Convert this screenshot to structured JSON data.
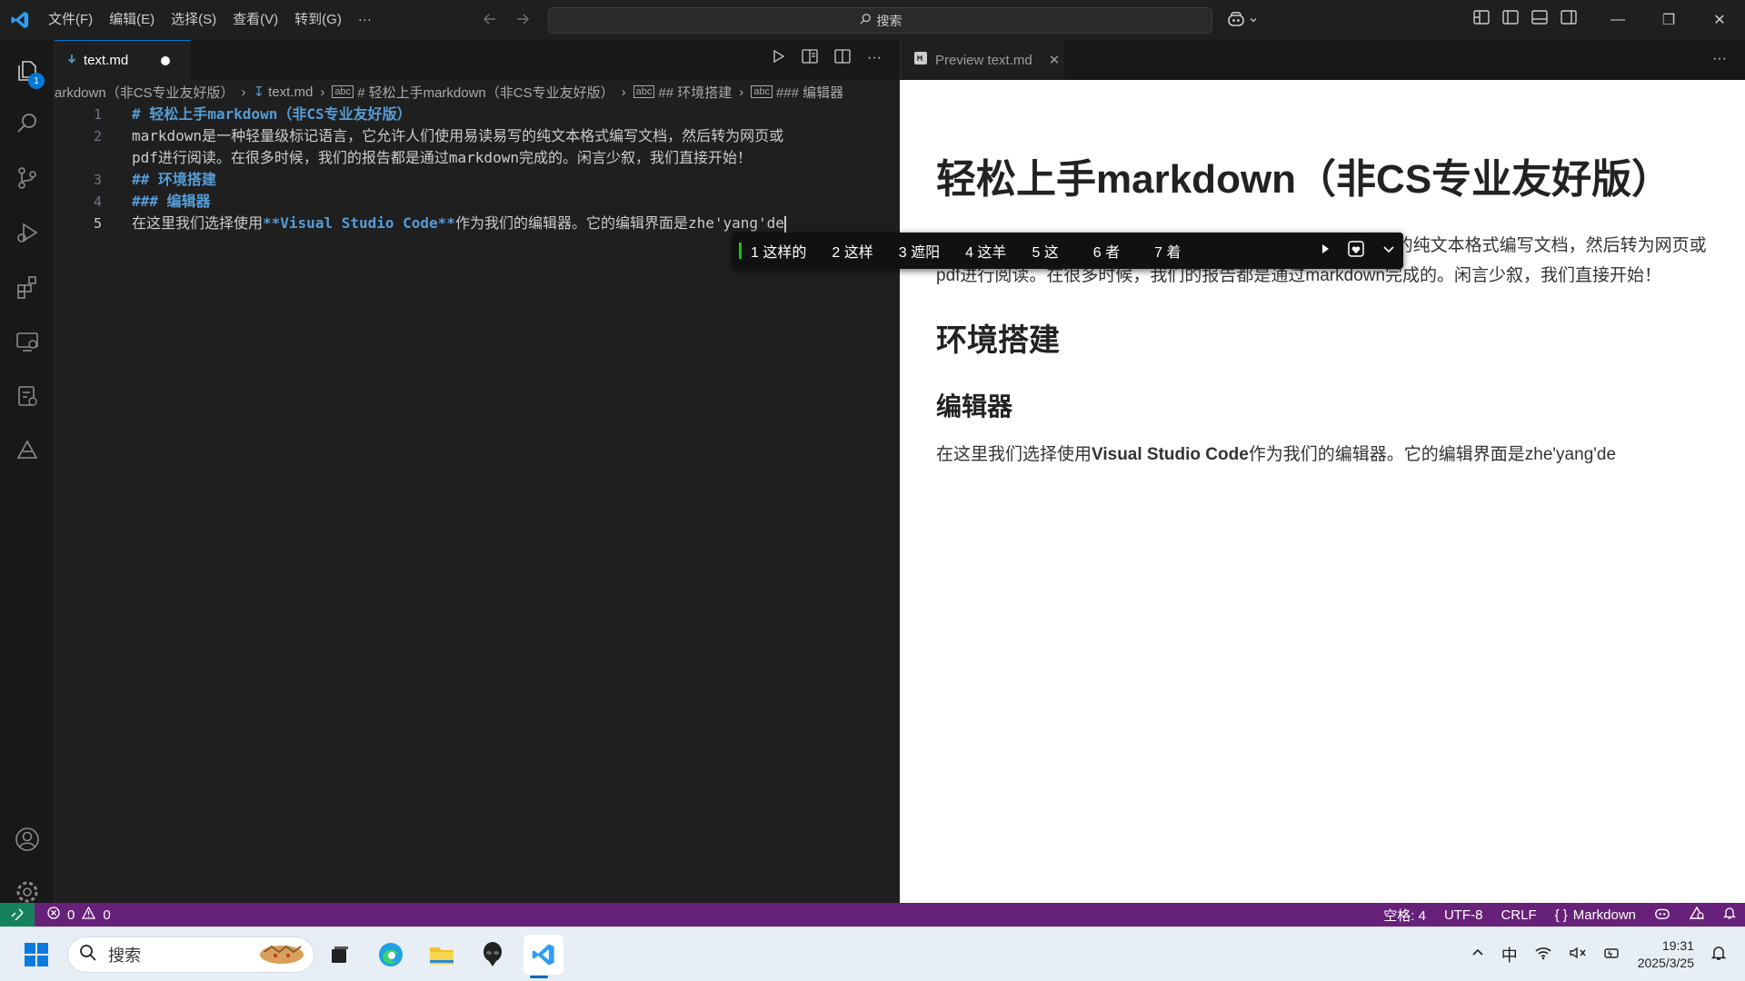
{
  "menu": [
    "文件(F)",
    "编辑(E)",
    "选择(S)",
    "查看(V)",
    "转到(G)",
    "···"
  ],
  "search": {
    "label": "搜索"
  },
  "activity": {
    "explorer_badge": "1"
  },
  "editor": {
    "tab_label": "text.md",
    "breadcrumb": [
      "arkdown（非CS专业友好版）",
      "text.md",
      "# 轻松上手markdown（非CS专业友好版）",
      "## 环境搭建",
      "### 编辑器"
    ],
    "lines": [
      {
        "n": "1",
        "text": "# 轻松上手markdown（非CS专业友好版）"
      },
      {
        "n": "2",
        "text": "markdown是一种轻量级标记语言，它允许人们使用易读易写的纯文本格式编写文档，然后转为网页或"
      },
      {
        "n": "",
        "text": "pdf进行阅读。在很多时候，我们的报告都是通过markdown完成的。闲言少叙，我们直接开始！"
      },
      {
        "n": "3",
        "text": "## 环境搭建"
      },
      {
        "n": "4",
        "text": "### 编辑器"
      },
      {
        "n": "5",
        "pre": "在这里我们选择使用",
        "bold": "**Visual Studio Code**",
        "post": "作为我们的编辑器。它的编辑界面是zhe'yang'de"
      }
    ]
  },
  "ime": {
    "candidates": [
      "1 这样的",
      "2 这样",
      "3 遮阳",
      "4 这羊",
      "5 这",
      "6 者",
      "7 着"
    ]
  },
  "preview": {
    "tab_label": "Preview text.md",
    "h1": "轻松上手markdown（非CS专业友好版）",
    "p1": "markdown是一种轻量级标记语言，它允许人们使用易读易写的纯文本格式编写文档，然后转为网页或pdf进行阅读。在很多时候，我们的报告都是通过markdown完成的。闲言少叙，我们直接开始！",
    "h2": "环境搭建",
    "h3": "编辑器",
    "p2_pre": "在这里我们选择使用",
    "p2_bold": "Visual Studio Code",
    "p2_post": "作为我们的编辑器。它的编辑界面是zhe'yang'de"
  },
  "status": {
    "errors": "0",
    "warnings": "0",
    "indent": "空格: 4",
    "encoding": "UTF-8",
    "eol": "CRLF",
    "language": "Markdown"
  },
  "taskbar": {
    "search_placeholder": "搜索",
    "ime_mode": "中",
    "time": "19:31",
    "date": "2025/3/25"
  },
  "colors": {
    "accent": "#0078d4",
    "statusbar": "#68217a",
    "heading": "#569cd6"
  }
}
